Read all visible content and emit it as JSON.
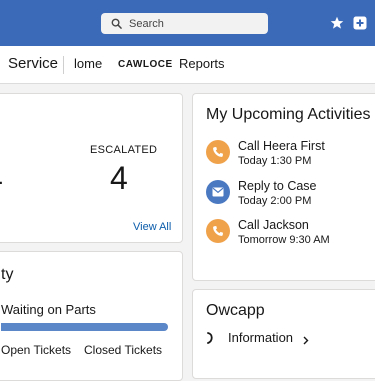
{
  "header": {
    "search_placeholder": "Search"
  },
  "nav": {
    "app_title": "Service",
    "items": [
      "lome",
      "CAWLOCE",
      "Reports"
    ]
  },
  "stats": {
    "left_label": "",
    "left_value": "4",
    "escalated_label": "ESCALATED",
    "escalated_value": "4",
    "view_all": "View All"
  },
  "activity_card": {
    "heading": "ty",
    "waiting_label": "Waiting on Parts",
    "progress_fraction": 1.0,
    "open_tickets_label": "Open Tickets",
    "closed_tickets_label": "Closed Tickets"
  },
  "upcoming": {
    "heading": "My Upcoming Activities",
    "items": [
      {
        "title": "Call Heera First",
        "time": "Today 1:30 PM",
        "icon": "phone-icon",
        "color": "#f0a24b"
      },
      {
        "title": "Reply to Case",
        "time": "Today 2:00 PM",
        "icon": "email-icon",
        "color": "#4a78c1"
      },
      {
        "title": "Call Jackson",
        "time": "Tomorrow 9:30 AM",
        "icon": "phone-icon",
        "color": "#f0a24b"
      }
    ]
  },
  "owcapp": {
    "heading": "Owcapp",
    "link_label": "Information"
  },
  "colors": {
    "header_bar": "#3b6ab8",
    "accent_blue": "#5b86c7"
  }
}
